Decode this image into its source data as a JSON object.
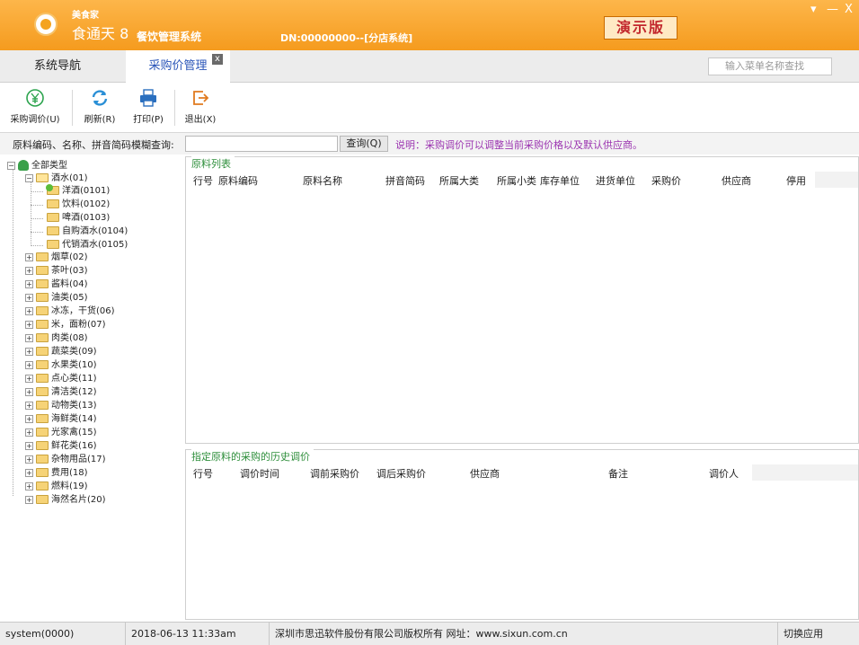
{
  "titlebar": {
    "brand_small": "美食家",
    "brand": "食通天 8",
    "brand_sub": "餐饮管理系统",
    "dn": "DN:00000000--[分店系统]",
    "demo": "演示版",
    "minimize": "▾",
    "restore": "—",
    "close": "X"
  },
  "tabs": {
    "nav": "系统导航",
    "active": "采购价管理",
    "close": "x"
  },
  "search": {
    "placeholder": "输入菜单名称查找"
  },
  "toolbar": {
    "adjust": "采购调价(U)",
    "refresh": "刷新(R)",
    "print": "打印(P)",
    "exit": "退出(X)"
  },
  "query": {
    "label": "原料编码、名称、拼音简码模糊查询:",
    "button": "查询(Q)",
    "note": "说明：采购调价可以调整当前采购价格以及默认供应商。"
  },
  "tree": {
    "root": "全部类型",
    "drinks": "酒水(01)",
    "drinks_children": [
      "洋酒(0101)",
      "饮料(0102)",
      "啤酒(0103)",
      "自购酒水(0104)",
      "代销酒水(0105)"
    ],
    "categories": [
      "烟草(02)",
      "茶叶(03)",
      "酱料(04)",
      "油类(05)",
      "冰冻，干货(06)",
      "米，面粉(07)",
      "肉类(08)",
      "蔬菜类(09)",
      "水果类(10)",
      "点心类(11)",
      "清洁类(12)",
      "动物类(13)",
      "海鲜类(14)",
      "光家禽(15)",
      "鲜花类(16)",
      "杂物用品(17)",
      "费用(18)",
      "燃料(19)",
      "海然名片(20)"
    ]
  },
  "materials": {
    "title": "原料列表",
    "columns": [
      "行号",
      "原料编码",
      "原料名称",
      "拼音简码",
      "所属大类",
      "所属小类",
      "库存单位",
      "进货单位",
      "采购价",
      "供应商",
      "停用"
    ]
  },
  "history": {
    "title": "指定原料的采购的历史调价",
    "columns": [
      "行号",
      "调价时间",
      "调前采购价",
      "调后采购价",
      "供应商",
      "备注",
      "调价人"
    ]
  },
  "status": {
    "user": "system(0000)",
    "datetime": "2018-06-13 11:33am",
    "copyright": "深圳市思迅软件股份有限公司版权所有 网址：www.sixun.com.cn",
    "switch": "切换应用"
  }
}
